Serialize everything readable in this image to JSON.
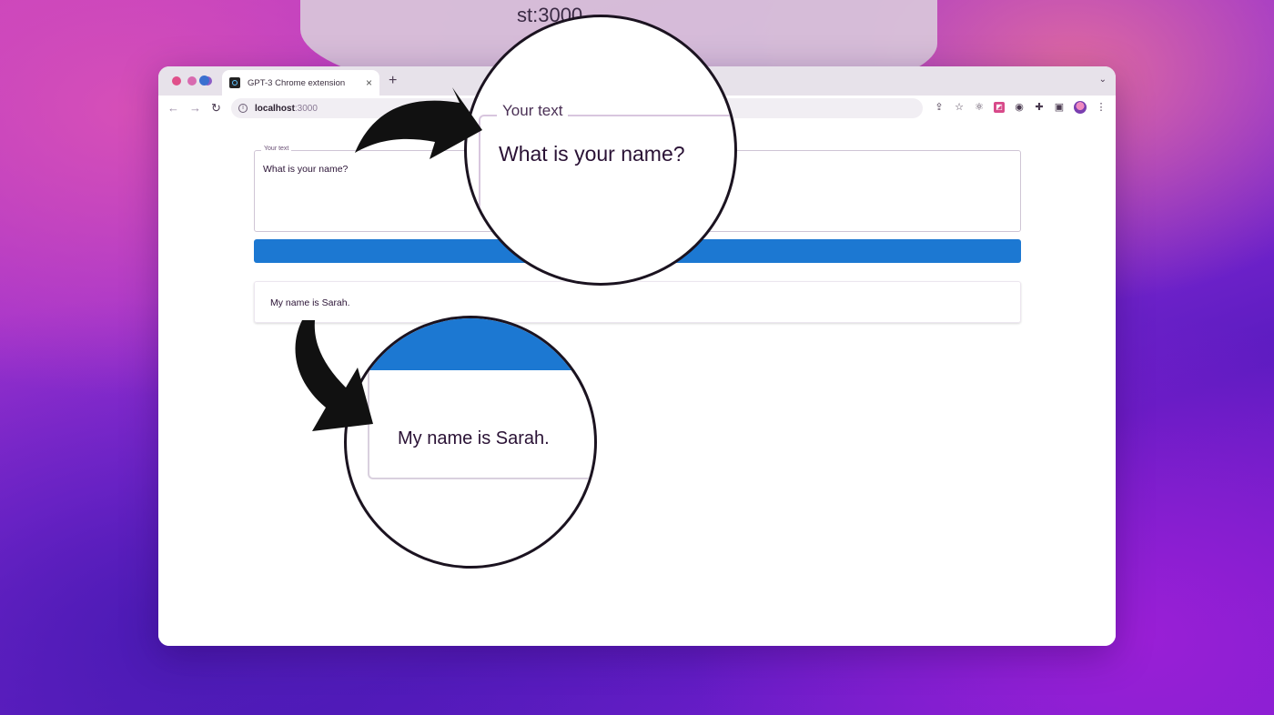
{
  "browser": {
    "tab_title": "GPT-3 Chrome extension",
    "tab_close": "×",
    "new_tab": "+",
    "tab_menu": "⌄",
    "url_host": "localhost",
    "url_port": ":3000"
  },
  "nav": {
    "back": "←",
    "forward": "→",
    "reload": "↻"
  },
  "form": {
    "legend": "Your text",
    "value": "What is your name?"
  },
  "result": {
    "text": "My name is Sarah."
  },
  "zoom_top": {
    "ghost_url": "st:3000",
    "legend": "Your text",
    "value": "What is your name?"
  },
  "zoom_bottom": {
    "text": "My name is Sarah."
  },
  "colors": {
    "button": "#1c78d2",
    "arrow": "#111111"
  },
  "icons": [
    "share-icon",
    "star-icon",
    "extension-icon",
    "pink-extension-icon",
    "globe-icon",
    "puzzle-icon",
    "sidepanel-icon",
    "avatar",
    "more-icon"
  ]
}
